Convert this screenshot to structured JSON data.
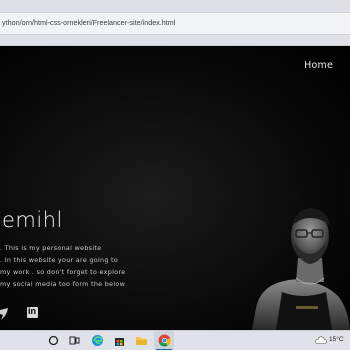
{
  "browser": {
    "url": "ython/orn/html-css-ornekleri/Freelancer-site/index.html"
  },
  "nav": {
    "home_label": "Home"
  },
  "hero": {
    "title": "emihl",
    "text_lines": [
      ". This is my personal website",
      ". In this website your are going to",
      "my work . so don't forget to explore",
      "my social media too form the below"
    ]
  },
  "social": {
    "icons": [
      "twitter-icon",
      "linkedin-icon"
    ],
    "linkedin_glyph": "in"
  },
  "taskbar": {
    "icons": [
      "search-circle-icon",
      "task-view-icon",
      "edge-icon",
      "store-icon",
      "file-explorer-icon",
      "chrome-icon",
      "cloud-weather-icon"
    ],
    "temperature": "15°C"
  },
  "colors": {
    "page_background": "#000000",
    "taskbar_background": "#dfe3e9",
    "taskbar_accent": "#0a64c8"
  }
}
